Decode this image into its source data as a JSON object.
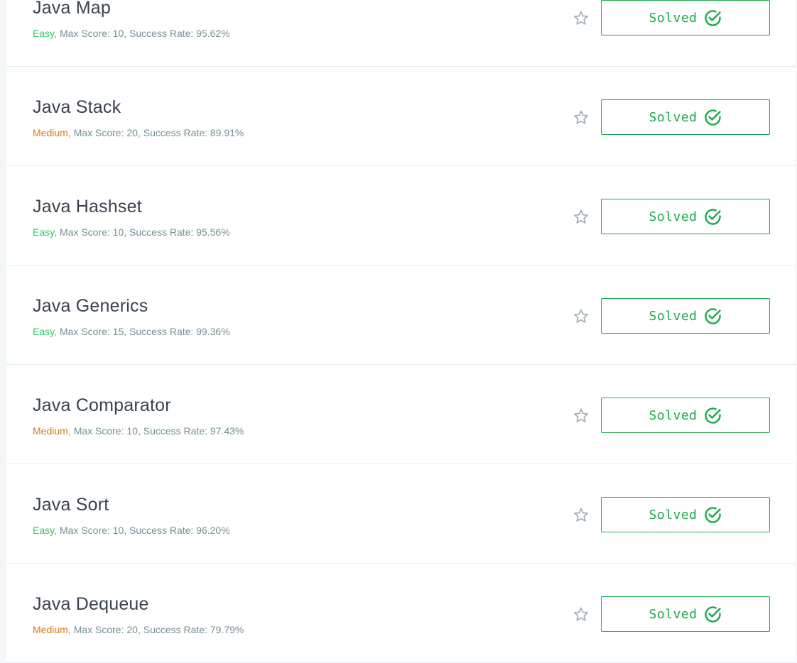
{
  "challenges": [
    {
      "title": "Java Map",
      "difficulty": "Easy,",
      "difficulty_level": "easy",
      "max_score": "Max Score: 10,",
      "success_rate": "Success Rate: 95.62%",
      "status": "Solved"
    },
    {
      "title": "Java Stack",
      "difficulty": "Medium,",
      "difficulty_level": "medium",
      "max_score": "Max Score: 20,",
      "success_rate": "Success Rate: 89.91%",
      "status": "Solved"
    },
    {
      "title": "Java Hashset",
      "difficulty": "Easy,",
      "difficulty_level": "easy",
      "max_score": "Max Score: 10,",
      "success_rate": "Success Rate: 95.56%",
      "status": "Solved"
    },
    {
      "title": "Java Generics",
      "difficulty": "Easy,",
      "difficulty_level": "easy",
      "max_score": "Max Score: 15,",
      "success_rate": "Success Rate: 99.36%",
      "status": "Solved"
    },
    {
      "title": "Java Comparator",
      "difficulty": "Medium,",
      "difficulty_level": "medium",
      "max_score": "Max Score: 10,",
      "success_rate": "Success Rate: 97.43%",
      "status": "Solved"
    },
    {
      "title": "Java Sort",
      "difficulty": "Easy,",
      "difficulty_level": "easy",
      "max_score": "Max Score: 10,",
      "success_rate": "Success Rate: 96.20%",
      "status": "Solved"
    },
    {
      "title": "Java Dequeue",
      "difficulty": "Medium,",
      "difficulty_level": "medium",
      "max_score": "Max Score: 20,",
      "success_rate": "Success Rate: 79.79%",
      "status": "Solved"
    }
  ],
  "icons": {
    "star": "star-outline-icon",
    "check": "check-circle-icon"
  },
  "colors": {
    "easy": "#2ec866",
    "medium": "#d37a1a",
    "solved": "#1ba94c",
    "meta": "#738f93",
    "title": "#39424e",
    "star": "#a3b0b7"
  }
}
